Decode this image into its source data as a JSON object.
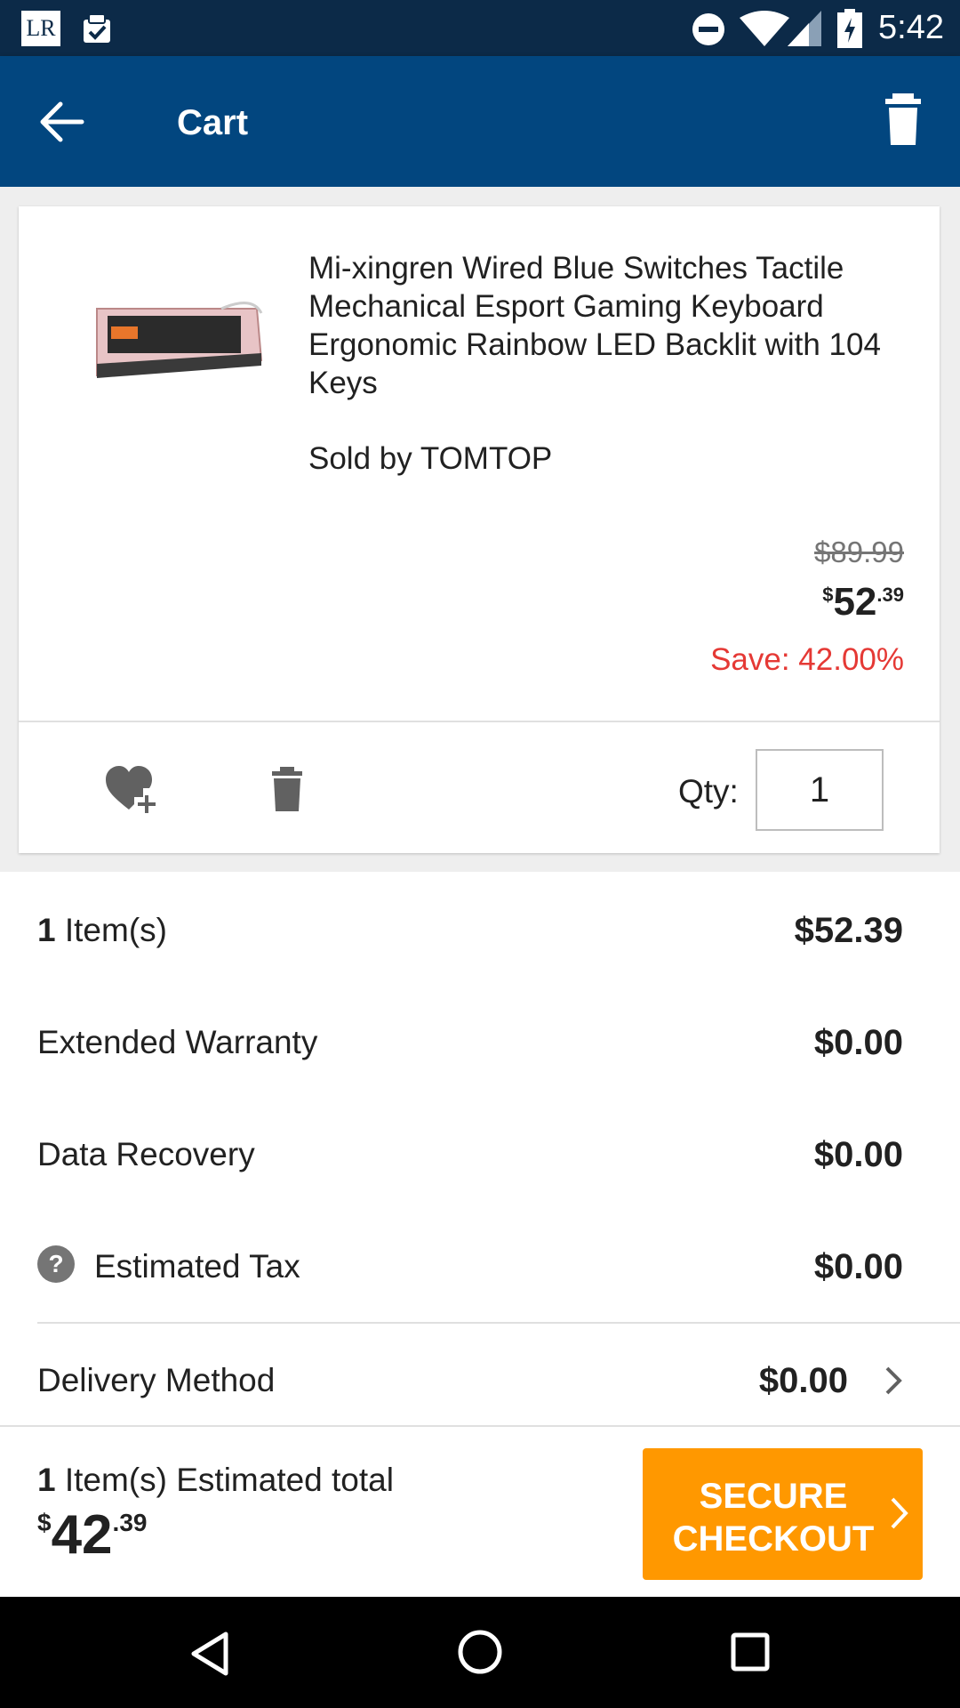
{
  "status_bar": {
    "time": "5:42",
    "lr_label": "LR"
  },
  "app_bar": {
    "title": "Cart"
  },
  "product": {
    "title": "Mi-xingren Wired Blue Switches Tactile Mechanical Esport Gaming Keyboard Ergonomic Rainbow LED Backlit with 104 Keys",
    "sold_by": "Sold by TOMTOP",
    "original_price": "$89.99",
    "price_currency": "$",
    "price_main": "52",
    "price_cents": ".39",
    "save_text": "Save: 42.00%",
    "qty_label": "Qty:",
    "qty_value": "1"
  },
  "summary": {
    "items_count": "1",
    "items_label": " Item(s)",
    "items_value": "$52.39",
    "warranty_label": "Extended Warranty",
    "warranty_value": "$0.00",
    "recovery_label": "Data Recovery",
    "recovery_value": "$0.00",
    "tax_label": "Estimated Tax",
    "tax_value": "$0.00",
    "delivery_label": "Delivery Method",
    "delivery_value": "$0.00"
  },
  "checkout": {
    "count": "1",
    "label": " Item(s) Estimated total",
    "total_currency": "$",
    "total_main": "42",
    "total_cents": ".39",
    "button_line1": "SECURE",
    "button_line2": "CHECKOUT"
  },
  "colors": {
    "status_bar": "#0c2a48",
    "app_bar": "#02467f",
    "save_red": "#e53935",
    "checkout_orange": "#ff9800"
  },
  "icons": [
    "lr-app-icon",
    "clipboard-check-icon",
    "dnd-icon",
    "wifi-icon",
    "signal-icon",
    "battery-charging-icon",
    "back-arrow-icon",
    "trash-icon",
    "heart-plus-icon",
    "help-icon",
    "chevron-right-icon",
    "nav-back-icon",
    "nav-home-icon",
    "nav-recents-icon"
  ]
}
